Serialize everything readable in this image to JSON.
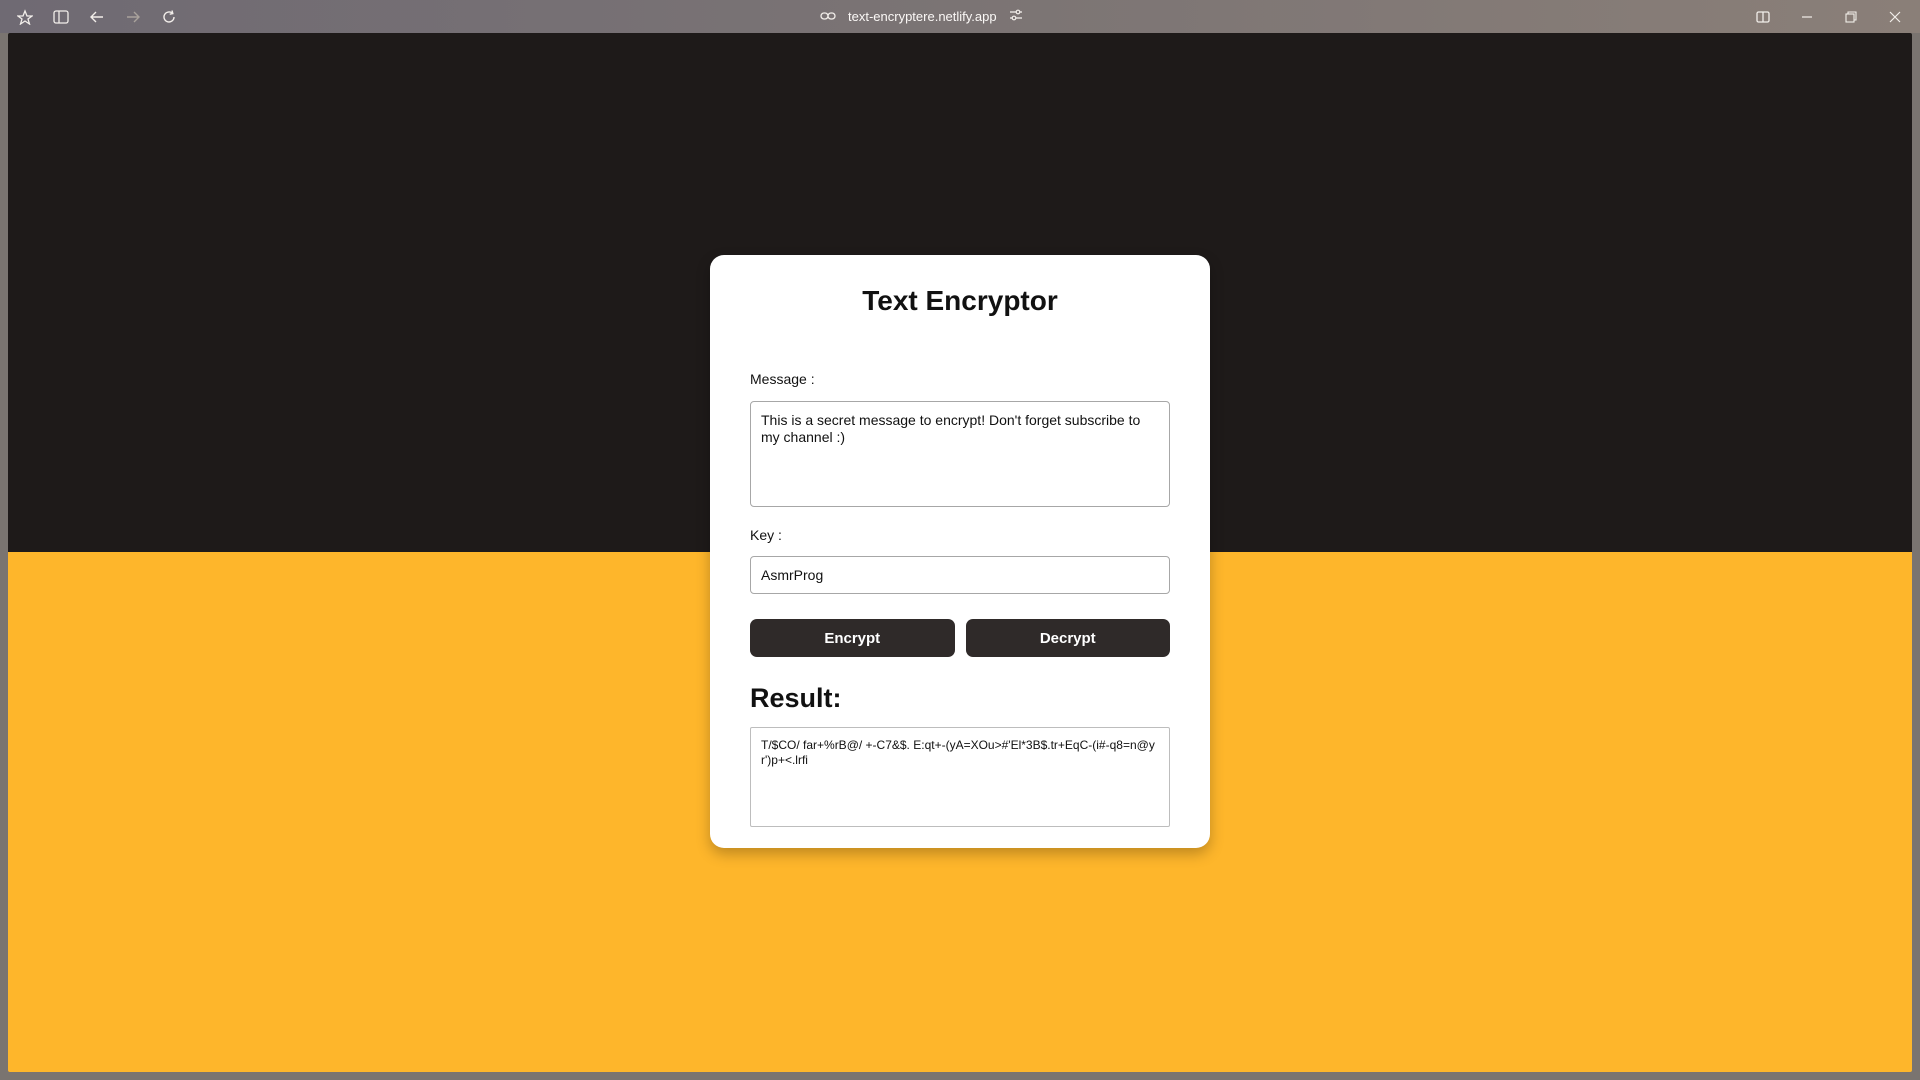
{
  "browser": {
    "url": "text-encryptere.netlify.app"
  },
  "app": {
    "title": "Text Encryptor",
    "message_label": "Message :",
    "message_value": "This is a secret message to encrypt! Don't forget subscribe to my channel :)",
    "key_label": "Key :",
    "key_value": "AsmrProg",
    "encrypt_label": "Encrypt",
    "decrypt_label": "Decrypt",
    "result_title": "Result:",
    "result_value": "T/$CO/ far+%rB@/ +-C7&$. E:qt+-(yA=XOu>#'El*3B$.tr+EqC-(i#-q8=n@yr')p+<.lrfi"
  },
  "colors": {
    "top_bg": "#1e1a19",
    "bottom_bg": "#feb62b",
    "button_bg": "#2f2a29"
  }
}
